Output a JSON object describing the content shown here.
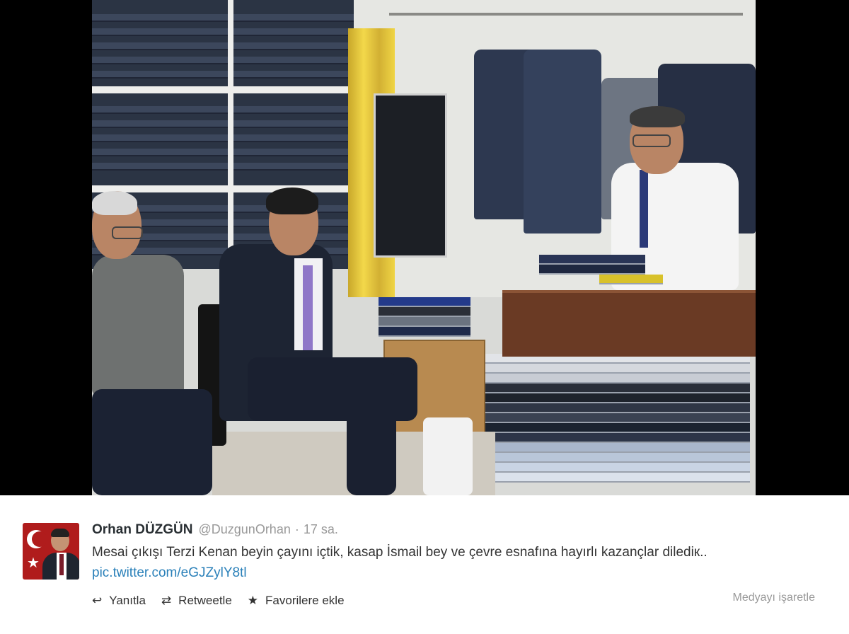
{
  "photo": {
    "description_icon": "photo-image"
  },
  "tweet": {
    "author_name": "Orhan DÜZGÜN",
    "author_handle": "@DuzgunOrhan",
    "separator": "·",
    "time": "17 sa.",
    "text_main": "Mesai çıkışı Terzi Kenan beyin çayını içtik, kasap İsmail bey ve çevre esnafına hayırlı kazançlar dilediк.. ",
    "link": "pic.twitter.com/eGJZylY8tl"
  },
  "actions": [
    {
      "icon": "reply-icon",
      "glyph": "↩",
      "label": "Yanıtla"
    },
    {
      "icon": "retweet-icon",
      "glyph": "⇄",
      "label": "Retweetle"
    },
    {
      "icon": "star-icon",
      "glyph": "★",
      "label": "Favorilere ekle"
    }
  ],
  "flag_media": "Medyayı işaretle",
  "avatar": {
    "icon": "turkish-flag-avatar",
    "star_glyph": "★"
  }
}
